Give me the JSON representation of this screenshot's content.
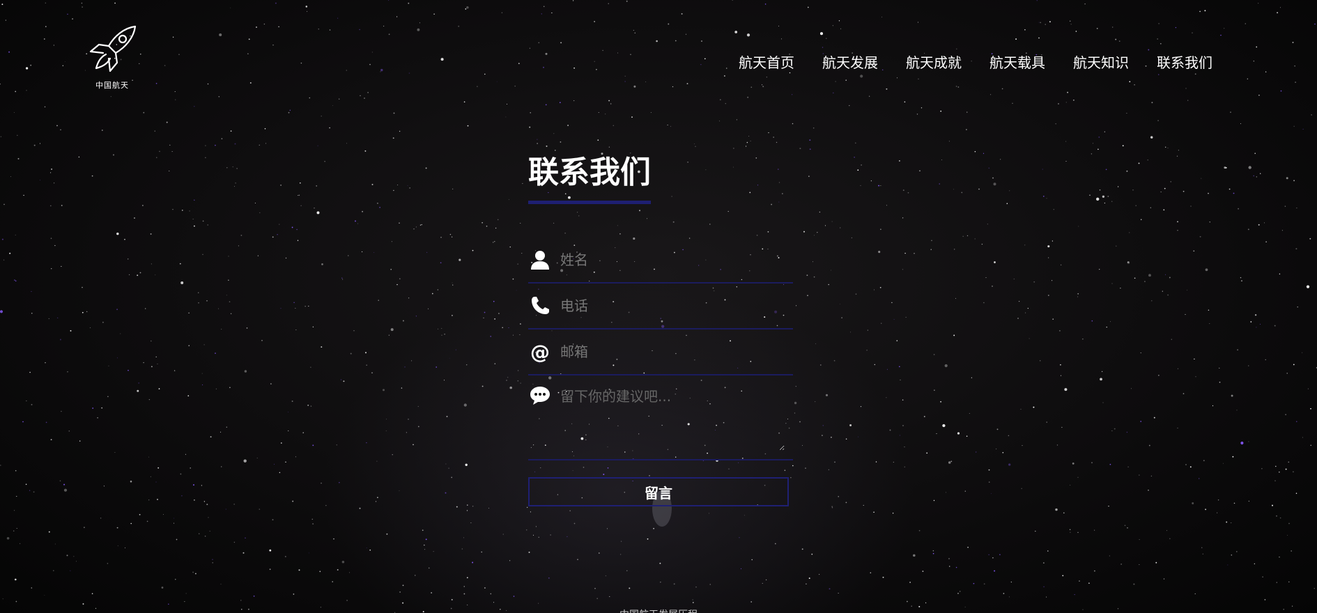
{
  "logo": {
    "text": "中国航天",
    "icon": "rocket-icon"
  },
  "nav": {
    "items": [
      {
        "label": "航天首页"
      },
      {
        "label": "航天发展"
      },
      {
        "label": "航天成就"
      },
      {
        "label": "航天载具"
      },
      {
        "label": "航天知识"
      },
      {
        "label": "联系我们"
      }
    ]
  },
  "contact": {
    "title": "联系我们",
    "accent_color": "#1e1f72",
    "fields": {
      "name": {
        "placeholder": "姓名",
        "value": "",
        "icon": "user-icon"
      },
      "phone": {
        "placeholder": "电话",
        "value": "",
        "icon": "phone-icon"
      },
      "email": {
        "placeholder": "邮箱",
        "value": "",
        "icon": "at-icon"
      },
      "message": {
        "placeholder": "留下你的建议吧...",
        "value": "",
        "icon": "chat-bubble-icon"
      }
    },
    "submit_label": "留言"
  },
  "footer": {
    "text": "中国航天发展历程"
  }
}
